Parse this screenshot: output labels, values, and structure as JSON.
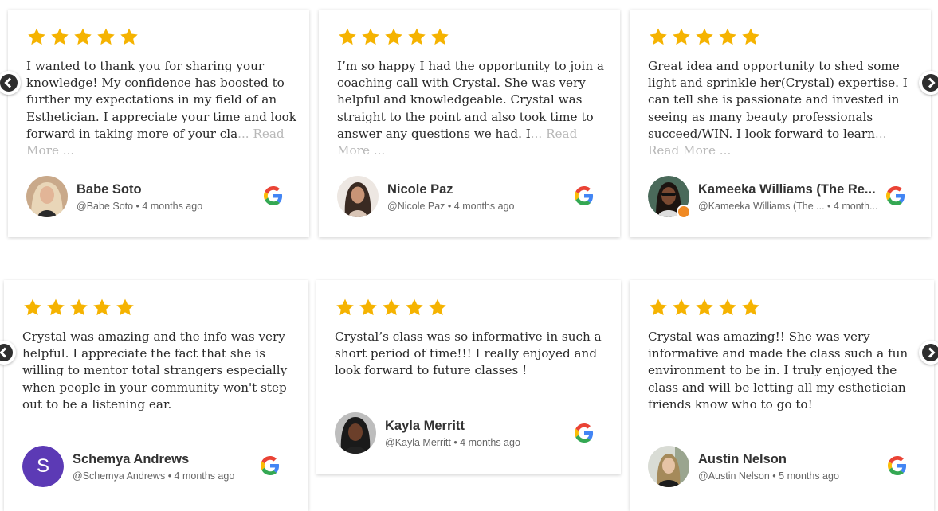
{
  "colors": {
    "star": "#f5b301",
    "avatar_purple": "#5c3ab5",
    "read_more": "#b8b8b8"
  },
  "icons": {
    "star": "star-icon",
    "google": "google-icon",
    "prev": "chevron-left-icon",
    "next": "chevron-right-icon"
  },
  "reviews": [
    {
      "rating": 5,
      "text": "I wanted to thank you for sharing your knowledge! My confidence has boosted to further my expectations in my field of an Esthetician. I appreciate your time and look forward in taking more of your cla",
      "read_more": "... Read More ...",
      "name": "Babe Soto",
      "handle": "@Babe Soto",
      "time": "4 months ago"
    },
    {
      "rating": 5,
      "text": "I’m so happy I had the opportunity to join a coaching call with Crystal. She was very helpful and knowledgeable. Crystal was straight to the point and also took time to answer any questions we had. I",
      "read_more": "... Read More ...",
      "name": "Nicole Paz",
      "handle": "@Nicole Paz",
      "time": "4 months ago"
    },
    {
      "rating": 5,
      "text": "Great idea and opportunity to shed some light and sprinkle her(Crystal) expertise. I can tell she is passionate and invested in seeing as many beauty professionals succeed/WIN. I look forward to learn",
      "read_more": "... Read More ...",
      "name": "Kameeka Williams (The Re...",
      "handle": "@Kameeka Williams (The ...",
      "time": "4 month..."
    },
    {
      "rating": 5,
      "text": "Crystal was amazing and the info was very helpful. I appreciate the fact that she is willing to mentor total strangers especially when people in your community won't step out to be a listening ear.",
      "read_more": "",
      "name": "Schemya Andrews",
      "handle": "@Schemya Andrews",
      "time": "4 months ago",
      "initial": "S"
    },
    {
      "rating": 5,
      "text": "Crystal’s class was so informative in such a short period of time!!! I really enjoyed and look forward to future classes !",
      "read_more": "",
      "name": "Kayla Merritt",
      "handle": "@Kayla Merritt",
      "time": "4 months ago"
    },
    {
      "rating": 5,
      "text": "Crystal was amazing!! She was very informative and made the class such a fun environment to be in. I truly enjoyed the class and will be letting all my esthetician friends know who to go to!",
      "read_more": "",
      "name": "Austin Nelson",
      "handle": "@Austin Nelson",
      "time": "5 months ago"
    }
  ]
}
